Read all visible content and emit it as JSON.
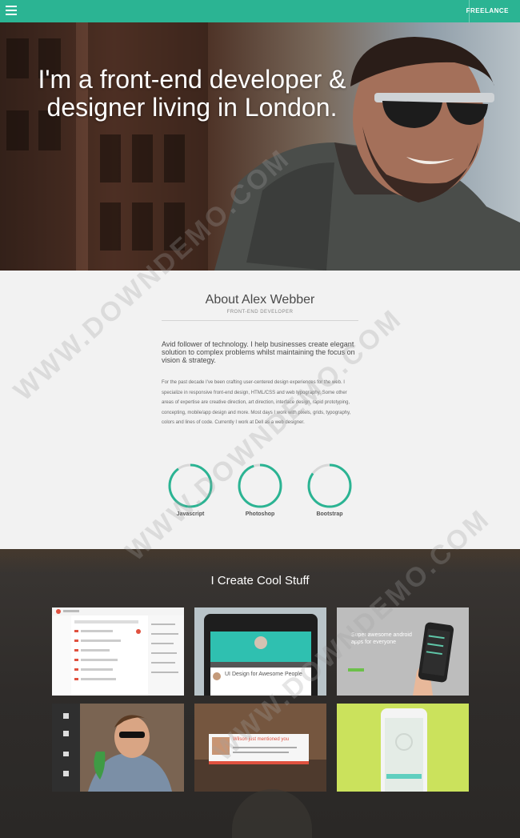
{
  "topbar": {
    "freelance_label": "FREELANCE",
    "menu_icon": "hamburger-icon",
    "accent": "#2bb493"
  },
  "hero": {
    "title": "I'm a front-end developer & designer living in London."
  },
  "about": {
    "title": "About Alex Webber",
    "subtitle": "FRONT-END DEVELOPER",
    "lead": "Avid follower of technology. I help businesses create elegant solution to complex problems whilst maintaining the focus on vision & strategy.",
    "body": "For the past decade I've been crafting user-centered design experiences for the web. I specialize in responsive front-end design, HTML/CSS and web typography. Some other areas of expertise are creative direction, art direction, interface design, rapid prototyping, concepting, mobile/app design and more. Most days I work with pixels, grids, typography, colors and lines of code. Currently I work at Dell as a web designer.",
    "skills": [
      {
        "label": "Javascript",
        "level": 0.9
      },
      {
        "label": "Photoshop",
        "level": 0.95
      },
      {
        "label": "Bootstrap",
        "level": 0.85
      }
    ]
  },
  "work": {
    "title": "I Create Cool Stuff",
    "tiles": [
      {
        "caption": ""
      },
      {
        "caption": "UI Design for Awesome People"
      },
      {
        "caption": "Super awesome android apps for everyone"
      },
      {
        "caption": ""
      },
      {
        "caption": "Wilson just mentioned you"
      },
      {
        "caption": ""
      }
    ]
  },
  "watermark": "WWW.DOWNDEMO.COM"
}
